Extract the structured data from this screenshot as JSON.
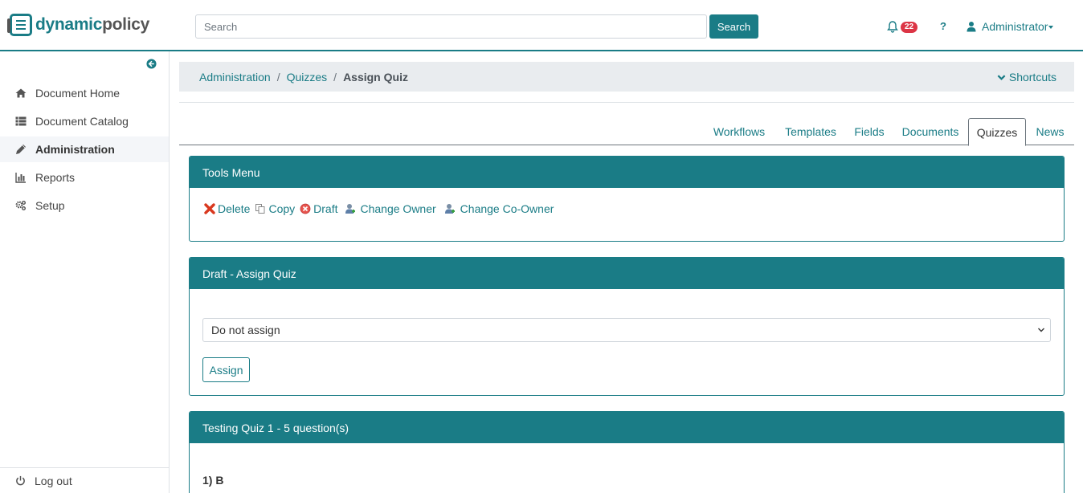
{
  "header": {
    "logo_part1": "dynamic",
    "logo_part2": "policy",
    "search_placeholder": "Search",
    "search_button": "Search",
    "notification_count": "22",
    "help_label": "?",
    "user_name": "Administrator"
  },
  "sidebar": {
    "items": [
      {
        "label": "Document Home",
        "icon": "home-icon"
      },
      {
        "label": "Document Catalog",
        "icon": "list-icon"
      },
      {
        "label": "Administration",
        "icon": "pencil-icon"
      },
      {
        "label": "Reports",
        "icon": "chart-icon"
      },
      {
        "label": "Setup",
        "icon": "gears-icon"
      }
    ],
    "logout": "Log out"
  },
  "breadcrumb": {
    "items": [
      "Administration",
      "Quizzes"
    ],
    "current": "Assign Quiz",
    "shortcuts": "Shortcuts"
  },
  "tabs": [
    "Workflows",
    "Templates",
    "Fields",
    "Documents",
    "Quizzes",
    "News"
  ],
  "tools_card": {
    "title": "Tools Menu",
    "items": [
      "Delete",
      "Copy",
      "Draft",
      "Change Owner",
      "Change Co-Owner"
    ]
  },
  "assign_card": {
    "title": "Draft - Assign Quiz",
    "select_value": "Do not assign",
    "button": "Assign"
  },
  "quiz_card": {
    "title": "Testing Quiz 1 - 5 question(s)",
    "question": "1) B"
  },
  "colors": {
    "accent": "#1a7c86",
    "badge": "#dc3545"
  }
}
